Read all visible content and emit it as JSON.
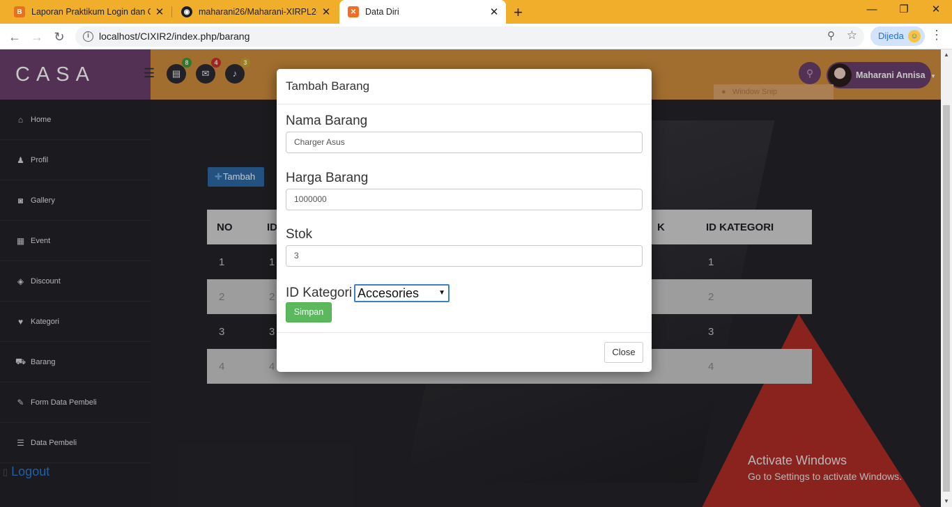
{
  "browser": {
    "tabs": [
      {
        "title": "Laporan Praktikum Login dan CR",
        "favicon": "blogger-icon"
      },
      {
        "title": "maharani26/Maharani-XIRPL2-22",
        "favicon": "github-icon"
      },
      {
        "title": "Data Diri",
        "favicon": "xampp-icon",
        "active": true
      }
    ],
    "close_glyph": "✕",
    "new_tab_glyph": "+",
    "url": "localhost/CIXIR2/index.php/barang",
    "paused_label": "Dijeda",
    "accent_color": "#f1ae2a"
  },
  "app": {
    "brand": "CASA",
    "header_badges": [
      "8",
      "4",
      "3"
    ],
    "user_name": "Maharani Annisa",
    "window_snip_label": "Window Snip",
    "colors": {
      "brand": "#6a3f6e",
      "header": "#cf8e3d",
      "sidebar": "#222228"
    }
  },
  "sidebar": {
    "items": [
      {
        "label": "Home",
        "icon": "home-icon"
      },
      {
        "label": "Profil",
        "icon": "user-icon"
      },
      {
        "label": "Gallery",
        "icon": "camera-icon"
      },
      {
        "label": "Event",
        "icon": "gift-icon"
      },
      {
        "label": "Discount",
        "icon": "tags-icon"
      },
      {
        "label": "Kategori",
        "icon": "heart-icon"
      },
      {
        "label": "Barang",
        "icon": "cart-icon"
      },
      {
        "label": "Form Data Pembeli",
        "icon": "pencil-icon"
      },
      {
        "label": "Data Pembeli",
        "icon": "list-icon"
      }
    ],
    "logout_label": "Logout"
  },
  "main": {
    "add_button_label": "Tambah",
    "table": {
      "columns": [
        "NO",
        "ID",
        "",
        "",
        "",
        "",
        "K",
        "ID KATEGORI"
      ],
      "rows": [
        [
          "1",
          "1",
          "1"
        ],
        [
          "2",
          "2",
          "2"
        ],
        [
          "3",
          "3",
          "3"
        ],
        [
          "4",
          "4",
          "4"
        ]
      ]
    }
  },
  "modal": {
    "title": "Tambah Barang",
    "fields": {
      "nama": {
        "label": "Nama Barang",
        "value": "Charger Asus"
      },
      "harga": {
        "label": "Harga Barang",
        "value": "1000000"
      },
      "stok": {
        "label": "Stok",
        "value": "3"
      },
      "kategori": {
        "label": "ID Kategori",
        "selected": "Accesories"
      }
    },
    "submit_label": "Simpan",
    "close_label": "Close"
  },
  "watermark": {
    "line1": "Activate Windows",
    "line2": "Go to Settings to activate Windows."
  }
}
